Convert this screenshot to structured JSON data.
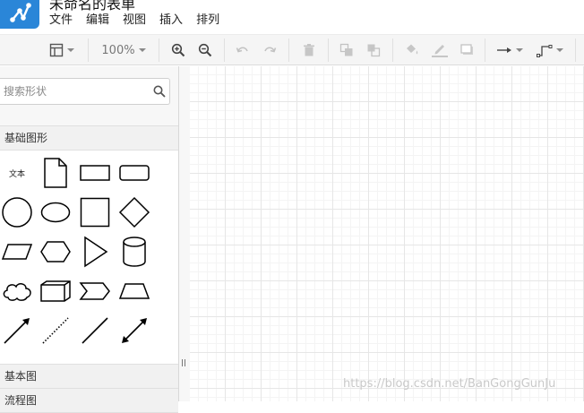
{
  "app": {
    "title": "未命名的表单",
    "logo_icon": "share-nodes-icon",
    "brand_color": "#2a86d8"
  },
  "menu": {
    "items": [
      "文件",
      "编辑",
      "视图",
      "插入",
      "排列"
    ]
  },
  "toolbar": {
    "zoom_label": "100%",
    "buttons": [
      "format-panel-icon",
      "zoom-in-icon",
      "zoom-out-icon",
      "undo-icon",
      "redo-icon",
      "delete-icon",
      "to-front-icon",
      "to-back-icon",
      "fill-color-icon",
      "line-color-icon",
      "shadow-icon",
      "connection-arrow-icon",
      "waypoints-icon"
    ]
  },
  "sidebar": {
    "search": {
      "placeholder": "搜索形状",
      "value": ""
    },
    "sections": [
      "基础图形",
      "基本图",
      "流程图"
    ],
    "shapes": {
      "text_shape_label": "文本",
      "items": [
        "text",
        "note",
        "rectangle",
        "rounded-rectangle",
        "circle",
        "ellipse",
        "square",
        "diamond",
        "parallelogram",
        "hexagon",
        "triangle",
        "cylinder",
        "cloud",
        "cube",
        "step",
        "trapezoid",
        "arrow",
        "dotted-line",
        "line",
        "bidirectional-arrow"
      ]
    }
  },
  "watermark": "https://blog.csdn.net/BanGongGunJu"
}
